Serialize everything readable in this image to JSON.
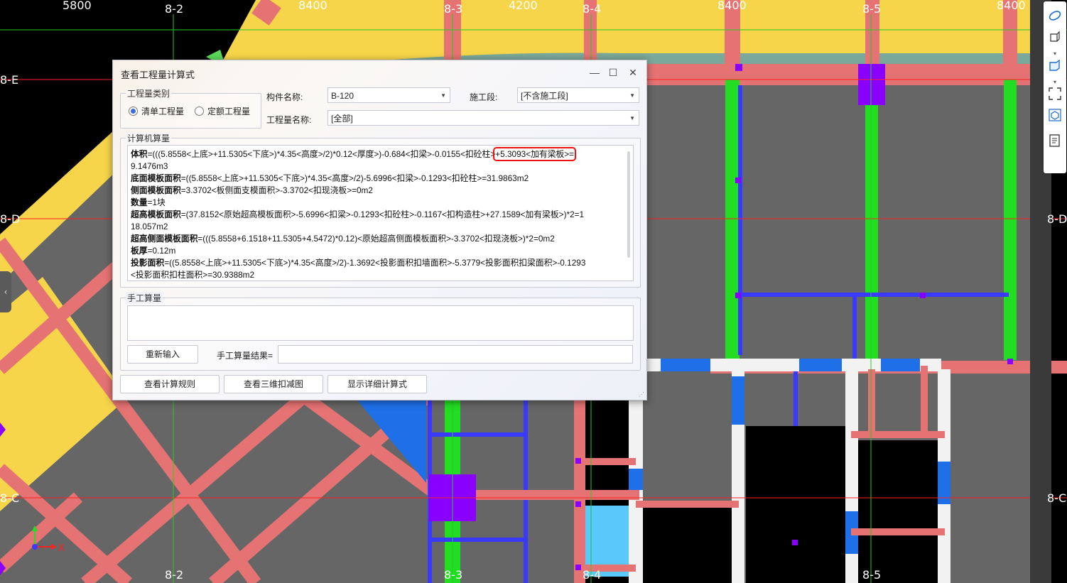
{
  "canvas": {
    "top_dimensions": [
      "5800",
      "8400",
      "4200",
      "8400",
      "8400"
    ],
    "grid_columns": [
      "8-2",
      "8-3",
      "8-4",
      "8-5"
    ],
    "grid_rows": [
      "8-E",
      "8-D",
      "8-C"
    ],
    "grid_rows_right": [
      "8-D",
      "8-C"
    ],
    "axis_x": "X"
  },
  "dialog": {
    "title": "查看工程量计算式",
    "quantity_type": {
      "label": "工程量类别",
      "options": [
        {
          "label": "清单工程量",
          "selected": true
        },
        {
          "label": "定额工程量",
          "selected": false
        }
      ]
    },
    "component_name": {
      "label": "构件名称:",
      "value": "B-120"
    },
    "construction_stage": {
      "label": "施工段:",
      "value": "[不含施工段]"
    },
    "quantity_name": {
      "label": "工程量名称:",
      "value": "[全部]"
    },
    "computer_calc": {
      "label": "计算机算量",
      "lines": [
        {
          "key": "体积",
          "text": "=(((5.8558<上底>+11.5305<下底>)*4.35<高度>/2)*0.12<厚度>)-0.684<扣梁>-0.0155<扣砼柱>",
          "highlight": "+5.3093<加有梁板>=",
          "after": ""
        },
        {
          "key": "",
          "text": "9.1476m3"
        },
        {
          "key": "底面模板面积",
          "text": "=((5.8558<上底>+11.5305<下底>)*4.35<高度>/2)-5.6996<扣梁>-0.1293<扣砼柱>=31.9863m2"
        },
        {
          "key": "侧面模板面积",
          "text": "=3.3702<板侧面支模面积>-3.3702<扣现浇板>=0m2"
        },
        {
          "key": "数量",
          "text": "=1块"
        },
        {
          "key": "超高模板面积",
          "text": "=(37.8152<原始超高模板面积>-5.6996<扣梁>-0.1293<扣砼柱>-0.1167<扣构造柱>+27.1589<加有梁板>)*2=1"
        },
        {
          "key": "",
          "text": "18.057m2"
        },
        {
          "key": "超高侧面模板面积",
          "text": "=(((5.8558+6.1518+11.5305+4.5472)*0.12)<原始超高侧面模板面积>-3.3702<扣现浇板>)*2=0m2"
        },
        {
          "key": "板厚",
          "text": "=0.12m"
        },
        {
          "key": "投影面积",
          "text": "=((5.8558<上底>+11.5305<下底>)*4.35<高度>/2)-1.3692<投影面积扣墙面积>-5.3779<投影面积扣梁面积>-0.1293"
        },
        {
          "key": "",
          "text": "<投影面积扣柱面积>=30.9388m2"
        }
      ]
    },
    "manual_calc": {
      "label": "手工算量",
      "reinput_button": "重新输入",
      "result_label": "手工算量结果="
    },
    "buttons": {
      "view_rules": "查看计算规则",
      "view_3d": "查看三维扣减图",
      "show_detail": "显示详细计算式"
    }
  }
}
